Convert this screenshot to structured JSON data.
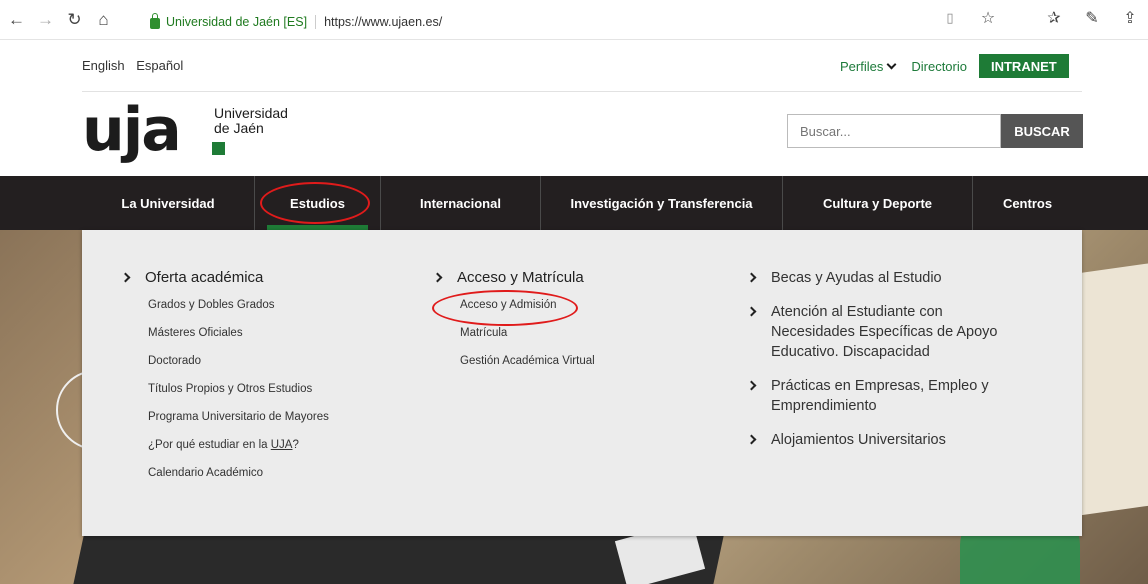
{
  "browser": {
    "back_icon": "←",
    "forward_icon": "→",
    "refresh_icon": "↻",
    "home_icon": "⌂",
    "site_name": "Universidad de Jaén [ES]",
    "url": "https://www.ujaen.es/",
    "reading_icon": "📖",
    "favorite_icon": "☆",
    "favorites_list_icon": "☆",
    "notes_icon": "✎",
    "share_icon": "⇪"
  },
  "header": {
    "lang_english": "English",
    "lang_spanish": "Español",
    "perfiles": "Perfiles",
    "directorio": "Directorio",
    "intranet": "INTRANET",
    "logo_main": "uja",
    "logo_sub_1": "Universidad",
    "logo_sub_2": "de Jaén",
    "search_placeholder": "Buscar...",
    "search_button": "BUSCAR"
  },
  "nav": {
    "items": [
      {
        "label": "La Universidad"
      },
      {
        "label": "Estudios"
      },
      {
        "label": "Internacional"
      },
      {
        "label": "Investigación y Transferencia"
      },
      {
        "label": "Cultura y Deporte"
      },
      {
        "label": "Centros"
      }
    ]
  },
  "dropdown": {
    "col1": {
      "heading": "Oferta académica",
      "items": [
        "Grados y Dobles Grados",
        "Másteres Oficiales",
        "Doctorado",
        "Títulos Propios y Otros Estudios",
        "Programa Universitario de Mayores",
        "¿Por qué estudiar en la ",
        "Calendario Académico"
      ],
      "uja_link": "UJA",
      "question_end": "?"
    },
    "col2": {
      "heading": "Acceso y Matrícula",
      "items": [
        "Acceso y Admisión",
        "Matrícula",
        "Gestión Académica Virtual"
      ]
    },
    "col3": {
      "items": [
        "Becas y Ayudas al Estudio",
        "Atención al Estudiante con Necesidades Específicas de Apoyo Educativo. Discapacidad",
        "Prácticas en Empresas, Empleo y Emprendimiento",
        "Alojamientos Universitarios"
      ]
    }
  },
  "colors": {
    "brand_green": "#1e7b36",
    "nav_bg": "#231f20",
    "annotation_red": "#e01b1b"
  }
}
